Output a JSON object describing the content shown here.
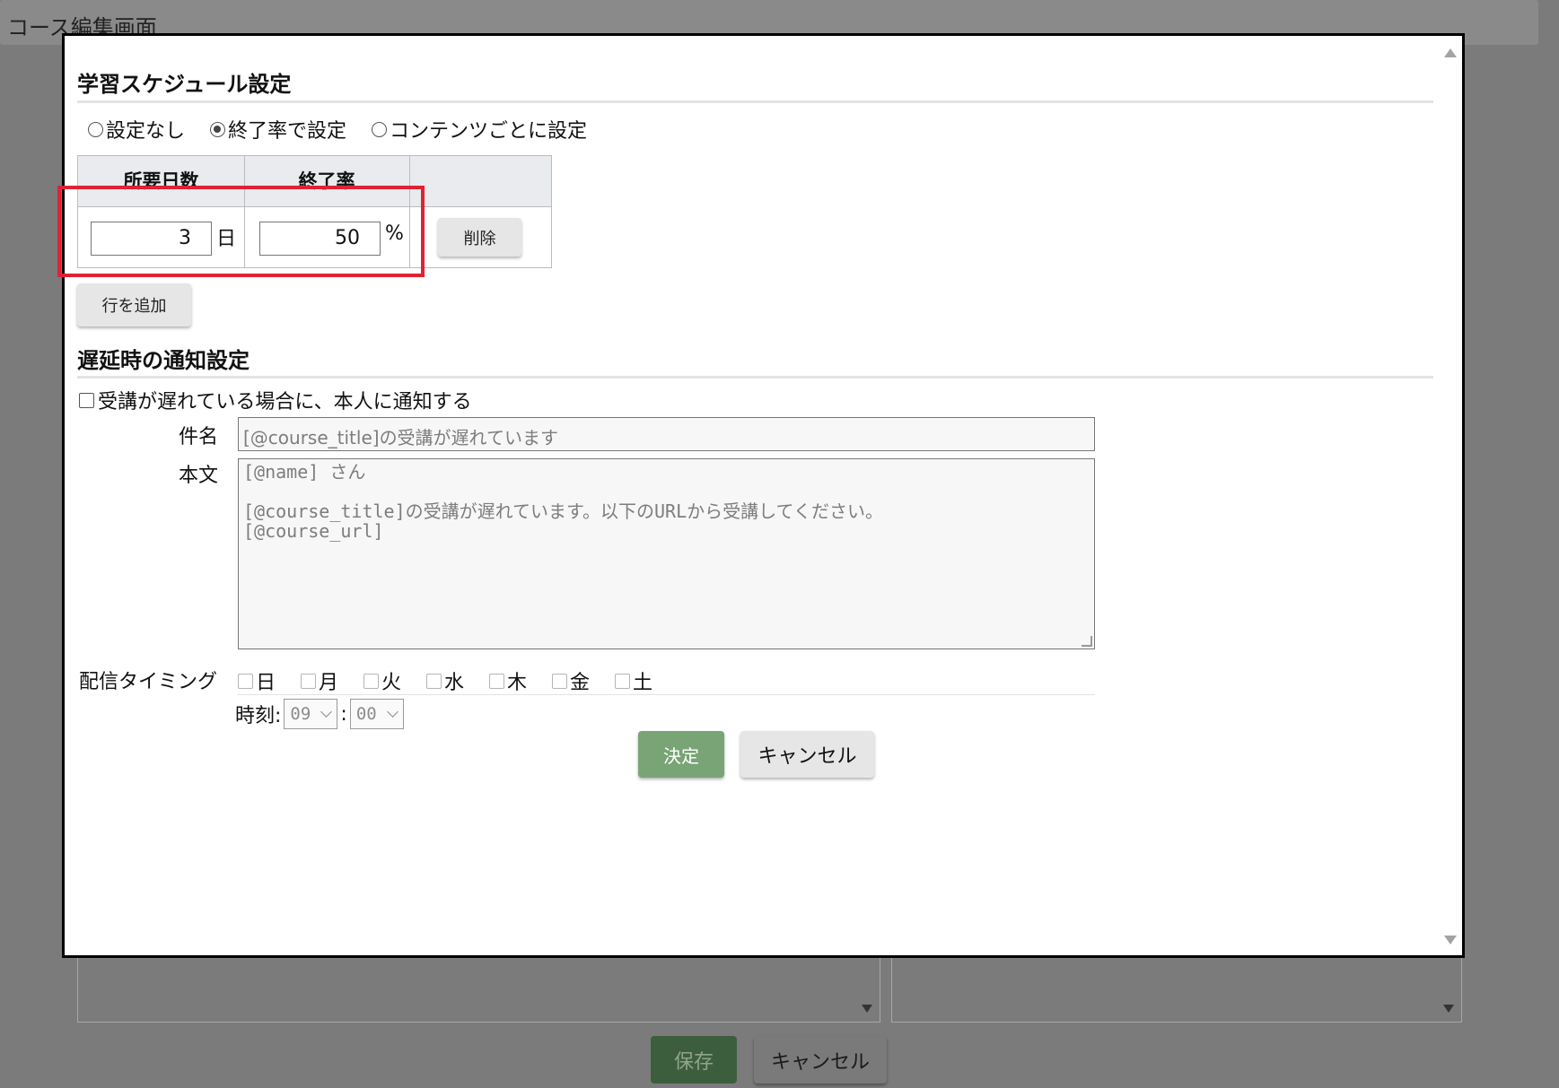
{
  "background": {
    "title": "コース編集画面",
    "save_label": "保存",
    "cancel_label": "キャンセル"
  },
  "schedule": {
    "heading": "学習スケジュール設定",
    "options": [
      {
        "label": "設定なし",
        "checked": false
      },
      {
        "label": "終了率で設定",
        "checked": true
      },
      {
        "label": "コンテンツごとに設定",
        "checked": false
      }
    ],
    "columns": [
      "所要日数",
      "終了率"
    ],
    "row": {
      "days": "3",
      "day_unit": "日",
      "rate": "50",
      "rate_unit": "%",
      "delete_label": "削除"
    },
    "add_row_label": "行を追加"
  },
  "delay": {
    "heading": "遅延時の通知設定",
    "notify_label": "受講が遅れている場合に、本人に通知する",
    "notify_checked": false,
    "subject_label": "件名",
    "subject_value": "[@course_title]の受講が遅れています",
    "body_label": "本文",
    "body_value": "[@name] さん\n\n[@course_title]の受講が遅れています。以下のURLから受講してください。\n[@course_url]",
    "timing_label": "配信タイミング",
    "days": [
      "日",
      "月",
      "火",
      "水",
      "木",
      "金",
      "土"
    ],
    "time_label": "時刻:",
    "hour": "09",
    "minute_sep": ":",
    "minute": "00"
  },
  "actions": {
    "ok_label": "決定",
    "cancel_label": "キャンセル"
  },
  "colors": {
    "ok_button": "#79a476",
    "highlight_box": "#e02232",
    "overlay": "#7b7b7b"
  }
}
